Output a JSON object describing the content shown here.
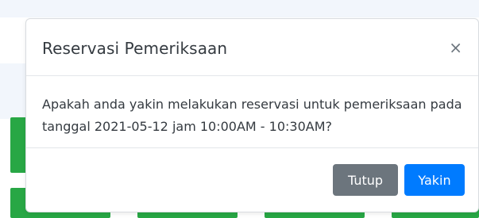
{
  "modal": {
    "title": "Reservasi Pemeriksaan",
    "close_icon": "×",
    "message": "Apakah anda yakin melakukan reservasi untuk pemeriksaan pada tanggal 2021-05-12 jam 10:00AM - 10:30AM?",
    "buttons": {
      "close_label": "Tutup",
      "confirm_label": "Yakin"
    }
  },
  "colors": {
    "primary": "#007bff",
    "secondary": "#6c757d",
    "tile_green": "#28a745"
  }
}
